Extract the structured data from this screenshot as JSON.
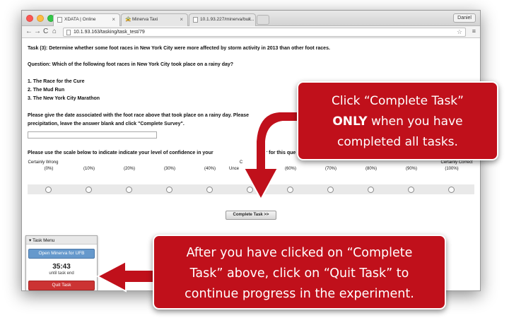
{
  "browser": {
    "tabs": [
      {
        "title": "XDATA | Online"
      },
      {
        "title": "Minerva Taxi"
      },
      {
        "title": "10.1.93.227/minerva/buil..."
      }
    ],
    "profile": "Daniel",
    "url": "10.1.93.163/tasking/task_test/79"
  },
  "task": {
    "title": "Task (3): Determine whether some foot races in New York City were more affected by storm activity in 2013 than other foot races.",
    "question": "Question: Which of the following foot races in New York City took place on a rainy day?",
    "options": [
      "1. The Race for the Cure",
      "2. The Mud Run",
      "3. The New York City Marathon"
    ],
    "date_prompt_line1": "Please give the date associated with the foot race above that took place on a rainy day. Please",
    "date_prompt_line2": "precipitation, leave the answer blank and click \"Complete Survey\".",
    "confidence_prompt": "Please use the scale below to indicate indicate your level of confidence in your",
    "confidence_prompt_tail": "er for this que",
    "scale": {
      "left_label": "Certainly Wrong",
      "right_label": "Certainly Correct",
      "mid_label_top": "C",
      "mid_label_bottom": "Unce",
      "mid_label_pct_tail": "%)",
      "percents": [
        "(0%)",
        "(10%)",
        "(20%)",
        "(30%)",
        "(40%)",
        "",
        "(60%)",
        "(70%)",
        "(80%)",
        "(90%)",
        "(100%)"
      ]
    },
    "complete_button": "Complete Task >>"
  },
  "task_menu": {
    "header": "Task Menu",
    "open_button": "Open Minerva for UFB",
    "timer": "35:43",
    "timer_sub": "until task end",
    "quit_button": "Quit Task"
  },
  "callouts": {
    "top": {
      "line1": "Click “Complete Task”",
      "line2_bold": "ONLY",
      "line2_rest": " when you have",
      "line3": "completed all tasks."
    },
    "bottom": {
      "line1": "After you have clicked on “Complete",
      "line2": "Task” above, click on “Quit Task” to",
      "line3": "continue progress in the experiment."
    }
  },
  "colors": {
    "callout": "#c0101b",
    "open_button": "#6699cc",
    "quit_button": "#cc3333"
  }
}
